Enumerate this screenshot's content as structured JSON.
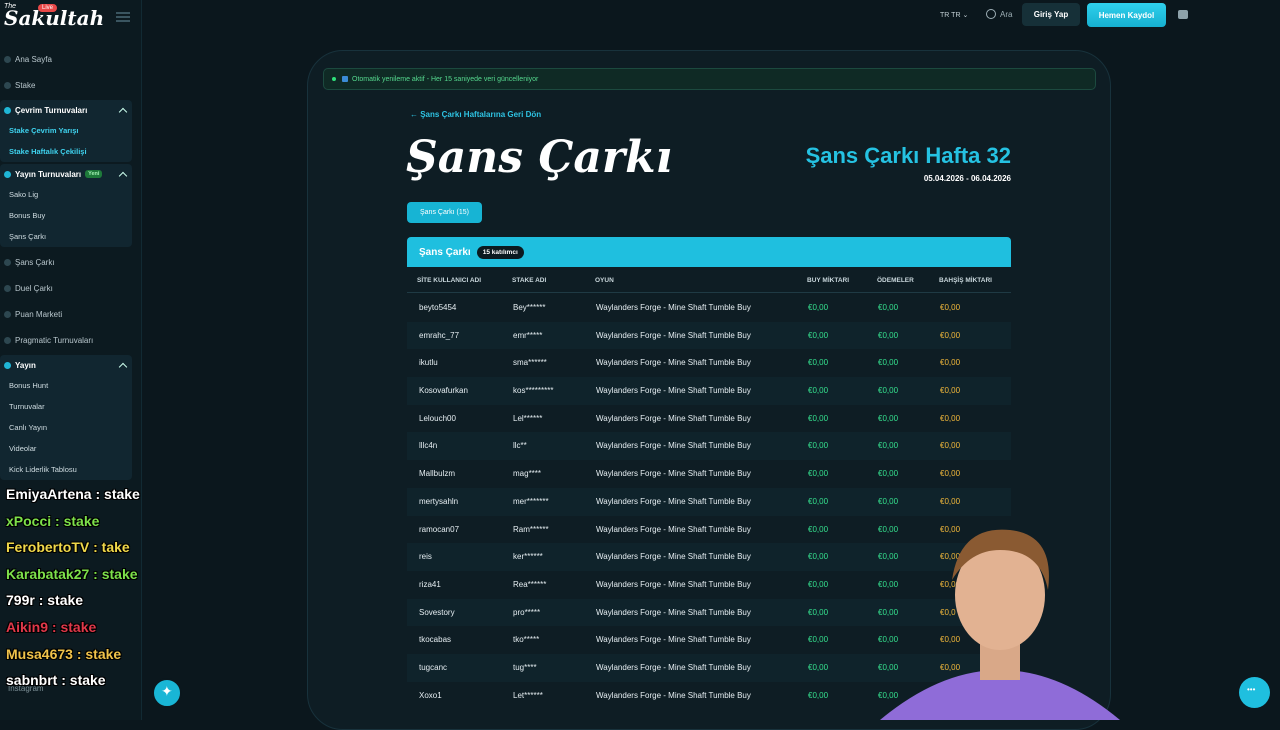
{
  "brand": {
    "small": "The",
    "name": "Sakultah",
    "live": "Live"
  },
  "sidebar": {
    "top_items": [
      "Ana Sayfa",
      "Stake"
    ],
    "group_cevrim": {
      "title": "Çevrim Turnuvaları",
      "items": [
        "Stake Çevrim Yarışı",
        "Stake Haftalık Çekilişi"
      ]
    },
    "group_yayin_turnuva": {
      "title": "Yayın Turnuvaları",
      "tag": "Yeni",
      "items": [
        "Sako Lig",
        "Bonus Buy",
        "Şans Çarkı"
      ]
    },
    "mid_items": [
      "Şans Çarkı",
      "Duel Çarkı",
      "Puan Marketi",
      "Pragmatic Turnuvaları"
    ],
    "group_yayin": {
      "title": "Yayın",
      "items": [
        "Bonus Hunt",
        "Turnuvalar",
        "Canlı Yayın",
        "Videolar",
        "Kick Liderlik Tablosu"
      ]
    }
  },
  "topbar": {
    "lang": "TR",
    "lang2": "TR",
    "search": "Ara",
    "login": "Giriş Yap",
    "register": "Hemen Kaydol"
  },
  "refresh_text": "Otomatik yenileme aktif - Her 15 saniyede veri güncelleniyor",
  "back_link": "← Şans Çarkı Haftalarına Geri Dön",
  "page_title": "Şans Çarkı",
  "week_title": "Şans Çarkı Hafta 32",
  "week_dates": "05.04.2026 - 06.04.2026",
  "tab": "Şans Çarkı (15)",
  "table": {
    "title": "Şans Çarkı",
    "count": "15 katılımcı",
    "headers": [
      "SİTE KULLANICI ADI",
      "STAKE ADI",
      "OYUN",
      "BUY MİKTARI",
      "ÖDEMELER",
      "BAHŞİŞ MİKTARI"
    ],
    "rows": [
      [
        "beyto5454",
        "Bey******",
        "Waylanders Forge - Mine Shaft Tumble Buy",
        "€0,00",
        "€0,00",
        "€0,00"
      ],
      [
        "emrahc_77",
        "emr*****",
        "Waylanders Forge - Mine Shaft Tumble Buy",
        "€0,00",
        "€0,00",
        "€0,00"
      ],
      [
        "ikutlu",
        "sma******",
        "Waylanders Forge - Mine Shaft Tumble Buy",
        "€0,00",
        "€0,00",
        "€0,00"
      ],
      [
        "Kosovafurkan",
        "kos*********",
        "Waylanders Forge - Mine Shaft Tumble Buy",
        "€0,00",
        "€0,00",
        "€0,00"
      ],
      [
        "Lelouch00",
        "Lel******",
        "Waylanders Forge - Mine Shaft Tumble Buy",
        "€0,00",
        "€0,00",
        "€0,00"
      ],
      [
        "lllc4n",
        "llc**",
        "Waylanders Forge - Mine Shaft Tumble Buy",
        "€0,00",
        "€0,00",
        "€0,00"
      ],
      [
        "Mallbulzm",
        "mag****",
        "Waylanders Forge - Mine Shaft Tumble Buy",
        "€0,00",
        "€0,00",
        "€0,00"
      ],
      [
        "mertysahln",
        "mer*******",
        "Waylanders Forge - Mine Shaft Tumble Buy",
        "€0,00",
        "€0,00",
        "€0,00"
      ],
      [
        "ramocan07",
        "Ram******",
        "Waylanders Forge - Mine Shaft Tumble Buy",
        "€0,00",
        "€0,00",
        "€0,00"
      ],
      [
        "reis",
        "ker******",
        "Waylanders Forge - Mine Shaft Tumble Buy",
        "€0,00",
        "€0,00",
        "€0,00"
      ],
      [
        "riza41",
        "Rea******",
        "Waylanders Forge - Mine Shaft Tumble Buy",
        "€0,00",
        "€0,00",
        "€0,00"
      ],
      [
        "Sovestory",
        "pro*****",
        "Waylanders Forge - Mine Shaft Tumble Buy",
        "€0,00",
        "€0,00",
        "€0,0"
      ],
      [
        "tkocabas",
        "tko*****",
        "Waylanders Forge - Mine Shaft Tumble Buy",
        "€0,00",
        "€0,00",
        "€0,00"
      ],
      [
        "tugcanc",
        "tug****",
        "Waylanders Forge - Mine Shaft Tumble Buy",
        "€0,00",
        "€0,00",
        "€0,00"
      ],
      [
        "Xoxo1",
        "Let******",
        "Waylanders Forge - Mine Shaft Tumble Buy",
        "€0,00",
        "€0,00",
        "€0,00"
      ]
    ]
  },
  "stream_chat": [
    "EmiyaArtena : stake",
    "xPocci : stake",
    "FerobertoTV : take",
    "Karabatak27 : stake",
    "799r : stake",
    "Aikin9 : stake",
    "Musa4673 : stake",
    "sabnbrt : stake"
  ],
  "chat_colors": [
    "#ffffff",
    "#7de04a",
    "#f0d84a",
    "#7de04a",
    "#ffffff",
    "#e0384a",
    "#f0c24a",
    "#ffffff"
  ],
  "sidebar_bottom": "Instagram"
}
